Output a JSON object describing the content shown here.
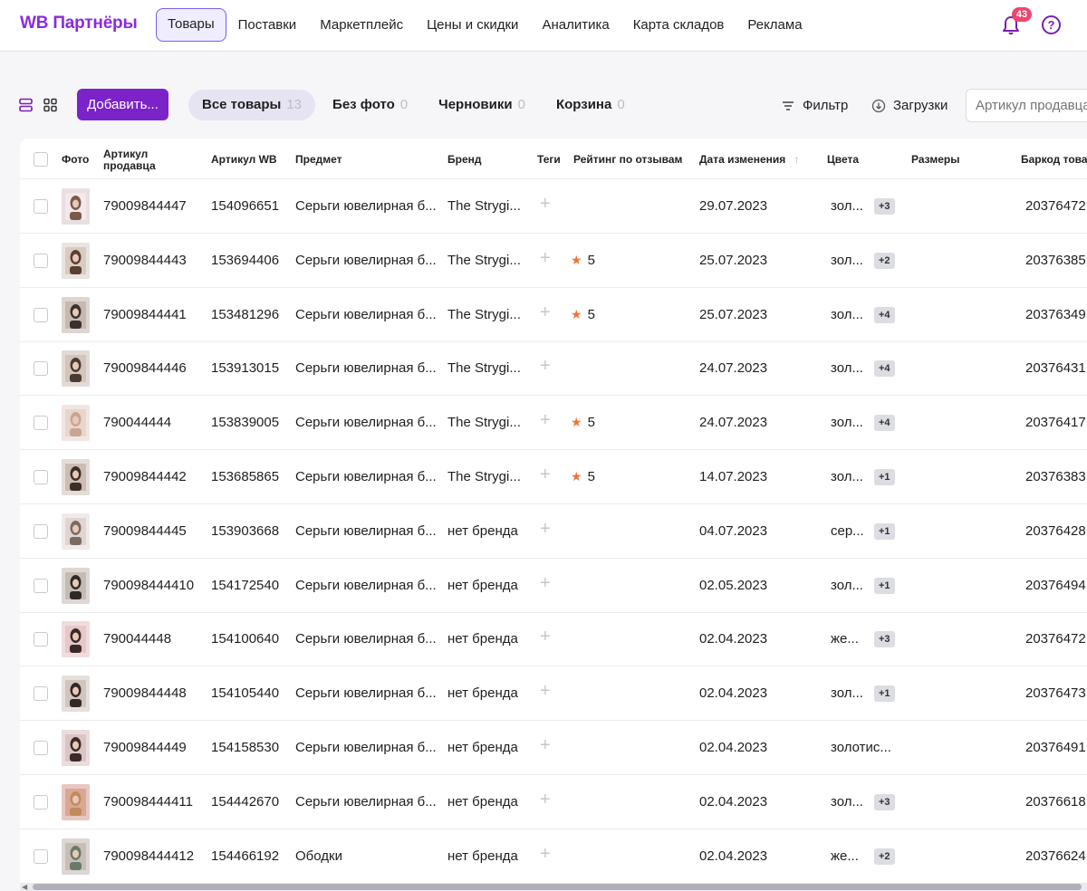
{
  "header": {
    "logo": "WB Партнёры",
    "nav": [
      {
        "label": "Товары",
        "active": true
      },
      {
        "label": "Поставки"
      },
      {
        "label": "Маркетплейс"
      },
      {
        "label": "Цены и скидки"
      },
      {
        "label": "Аналитика"
      },
      {
        "label": "Карта складов"
      },
      {
        "label": "Реклама"
      }
    ],
    "notifications_count": "43",
    "help_label": "?"
  },
  "toolbar": {
    "add_label": "Добавить...",
    "tabs": [
      {
        "label": "Все товары",
        "count": "13",
        "active": true
      },
      {
        "label": "Без фото",
        "count": "0"
      },
      {
        "label": "Черновики",
        "count": "0"
      },
      {
        "label": "Корзина",
        "count": "0"
      }
    ],
    "filter_label": "Фильтр",
    "loads_label": "Загрузки",
    "search_placeholder": "Артикул продавца"
  },
  "table": {
    "columns": {
      "photo": "Фото",
      "seller_sku": "Артикул продавца",
      "wb_sku": "Артикул WB",
      "subject": "Предмет",
      "brand": "Бренд",
      "tags": "Теги",
      "rating": "Рейтинг по отзывам",
      "changed": "Дата изменения",
      "colors": "Цвета",
      "sizes": "Размеры",
      "barcode": "Баркод товар"
    },
    "rows": [
      {
        "seller_sku": "79009844447",
        "wb_sku": "154096651",
        "subject": "Серьги ювелирная б...",
        "brand": "The Strygi...",
        "rating": "",
        "date": "29.07.2023",
        "color": "зол...",
        "more": "+3",
        "barcode": "20376472"
      },
      {
        "seller_sku": "79009844443",
        "wb_sku": "153694406",
        "subject": "Серьги ювелирная б...",
        "brand": "The Strygi...",
        "rating": "5",
        "date": "25.07.2023",
        "color": "зол...",
        "more": "+2",
        "barcode": "20376385"
      },
      {
        "seller_sku": "79009844441",
        "wb_sku": "153481296",
        "subject": "Серьги ювелирная б...",
        "brand": "The Strygi...",
        "rating": "5",
        "date": "25.07.2023",
        "color": "зол...",
        "more": "+4",
        "barcode": "20376349"
      },
      {
        "seller_sku": "79009844446",
        "wb_sku": "153913015",
        "subject": "Серьги ювелирная б...",
        "brand": "The Strygi...",
        "rating": "",
        "date": "24.07.2023",
        "color": "зол...",
        "more": "+4",
        "barcode": "20376431"
      },
      {
        "seller_sku": "790044444",
        "wb_sku": "153839005",
        "subject": "Серьги ювелирная б...",
        "brand": "The Strygi...",
        "rating": "5",
        "date": "24.07.2023",
        "color": "зол...",
        "more": "+4",
        "barcode": "20376417"
      },
      {
        "seller_sku": "79009844442",
        "wb_sku": "153685865",
        "subject": "Серьги ювелирная б...",
        "brand": "The Strygi...",
        "rating": "5",
        "date": "14.07.2023",
        "color": "зол...",
        "more": "+1",
        "barcode": "20376383"
      },
      {
        "seller_sku": "79009844445",
        "wb_sku": "153903668",
        "subject": "Серьги ювелирная б...",
        "brand": "нет бренда",
        "rating": "",
        "date": "04.07.2023",
        "color": "сер...",
        "more": "+1",
        "barcode": "20376428"
      },
      {
        "seller_sku": "790098444410",
        "wb_sku": "154172540",
        "subject": "Серьги ювелирная б...",
        "brand": "нет бренда",
        "rating": "",
        "date": "02.05.2023",
        "color": "зол...",
        "more": "+1",
        "barcode": "20376494"
      },
      {
        "seller_sku": "790044448",
        "wb_sku": "154100640",
        "subject": "Серьги ювелирная б...",
        "brand": "нет бренда",
        "rating": "",
        "date": "02.04.2023",
        "color": "же...",
        "more": "+3",
        "barcode": "20376472"
      },
      {
        "seller_sku": "79009844448",
        "wb_sku": "154105440",
        "subject": "Серьги ювелирная б...",
        "brand": "нет бренда",
        "rating": "",
        "date": "02.04.2023",
        "color": "зол...",
        "more": "+1",
        "barcode": "20376473"
      },
      {
        "seller_sku": "79009844449",
        "wb_sku": "154158530",
        "subject": "Серьги ювелирная б...",
        "brand": "нет бренда",
        "rating": "",
        "date": "02.04.2023",
        "color": "золотис...",
        "more": "",
        "barcode": "20376491"
      },
      {
        "seller_sku": "790098444411",
        "wb_sku": "154442670",
        "subject": "Серьги ювелирная б...",
        "brand": "нет бренда",
        "rating": "",
        "date": "02.04.2023",
        "color": "зол...",
        "more": "+3",
        "barcode": "20376618"
      },
      {
        "seller_sku": "790098444412",
        "wb_sku": "154466192",
        "subject": "Ободки",
        "brand": "нет бренда",
        "rating": "",
        "date": "02.04.2023",
        "color": "же...",
        "more": "+2",
        "barcode": "20376624"
      }
    ]
  }
}
